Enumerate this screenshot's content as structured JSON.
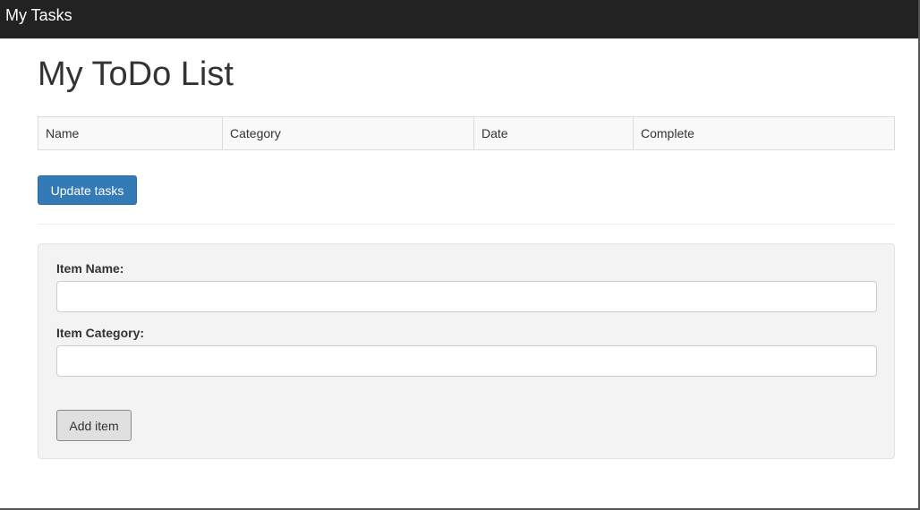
{
  "navbar": {
    "brand": "My Tasks",
    "background": "#222222"
  },
  "page": {
    "title": "My ToDo List"
  },
  "table": {
    "columns": [
      "Name",
      "Category",
      "Date",
      "Complete"
    ],
    "rows": []
  },
  "actions": {
    "update_label": "Update tasks",
    "primary_color": "#337ab7"
  },
  "form": {
    "item_name_label": "Item Name:",
    "item_name_value": "",
    "item_category_label": "Item Category:",
    "item_category_value": "",
    "add_label": "Add item"
  }
}
